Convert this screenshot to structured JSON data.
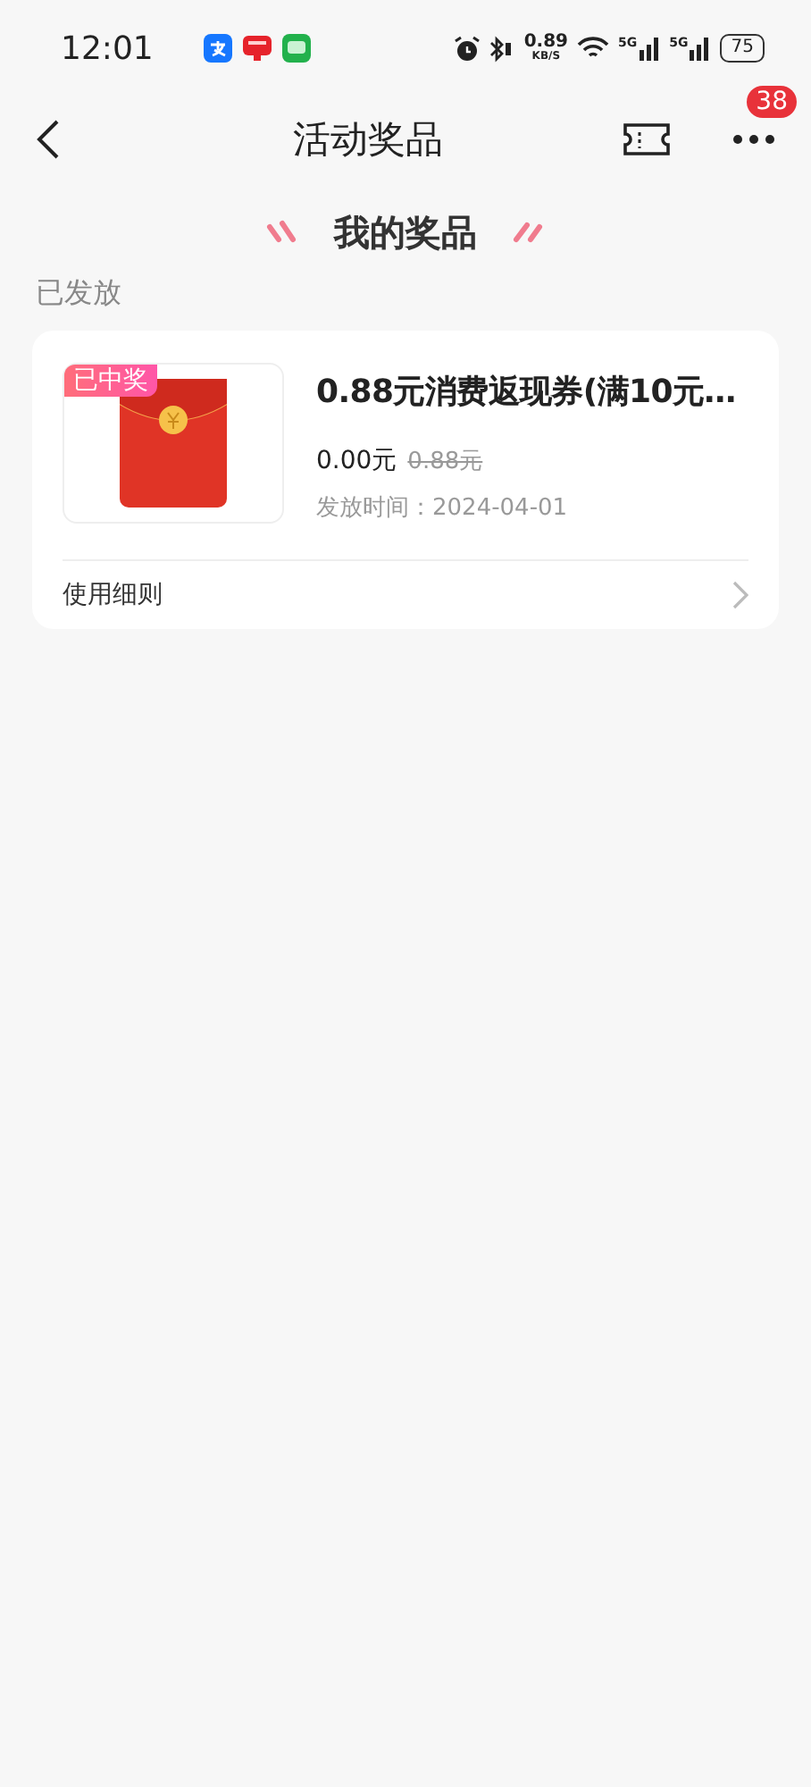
{
  "status_bar": {
    "time": "12:01",
    "net_speed": "0.89",
    "net_unit": "KB/S",
    "signals": [
      {
        "label": "5G"
      },
      {
        "label": "5G"
      }
    ],
    "battery": "75"
  },
  "nav": {
    "title": "活动奖品",
    "badge": "38"
  },
  "section_title": "我的奖品",
  "group_label": "已发放",
  "prizes": [
    {
      "tag": "已中奖",
      "title": "0.88元消费返现券(满10元…",
      "price": "0.00元",
      "original_price": "0.88元",
      "issued": "发放时间：2024-04-01",
      "rules_link": "使用细则"
    }
  ]
}
